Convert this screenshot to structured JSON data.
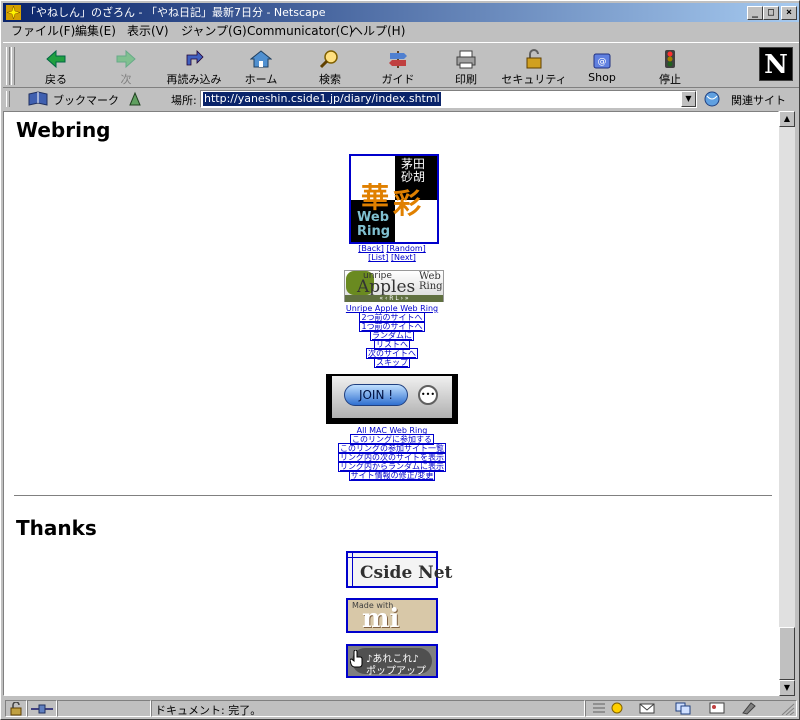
{
  "window": {
    "title": "「やねしん」のざろん - 「やね日記」最新7日分 - Netscape",
    "minimize": "_",
    "maximize": "□",
    "close": "×"
  },
  "menu": [
    "ファイル(F)",
    "編集(E)",
    "表示(V)",
    "ジャンプ(G)",
    "Communicator(C)",
    "ヘルプ(H)"
  ],
  "toolbar": {
    "back": "戻る",
    "forward": "次",
    "reload": "再読み込み",
    "home": "ホーム",
    "search": "検索",
    "guide": "ガイド",
    "print": "印刷",
    "security": "セキュリティ",
    "shop": "Shop",
    "stop": "停止",
    "logo": "N"
  },
  "locationbar": {
    "bookmarks_label": "ブックマーク",
    "location_label": "場所:",
    "url": "http://yaneshin.cside1.jp/diary/index.shtml",
    "related_label": "関連サイト"
  },
  "content": {
    "webring_heading": "Webring",
    "banner1": {
      "top_right": "茅田\n砂胡",
      "kanji1": "華",
      "kanji2": "彩",
      "web": "Web",
      "ring": "Ring"
    },
    "ring1_links": [
      "[Back]",
      "[Random]",
      "[List]",
      "[Next]"
    ],
    "banner2": {
      "unripe": "unripe",
      "apples": "Apples",
      "web": "Web",
      "ring": "Ring",
      "controls": "« ‹ R L › »"
    },
    "ring2_title": "Unripe Apple Web Ring",
    "ring2_links": [
      "2つ前のサイトへ",
      "1つ前のサイトへ",
      "ランダムに",
      "リストへ",
      "次のサイトへ",
      "スキップ"
    ],
    "banner3": {
      "join": "JOIN !"
    },
    "ring3_title": "All MAC Web Ring",
    "ring3_links": [
      "このリングに参加する",
      "このリングの参加サイト一覧",
      "リング内の次のサイトを表示",
      "リング内からランダムに表示",
      "サイト情報の修正/変更"
    ],
    "thanks_heading": "Thanks",
    "thanks1": "Cside Net",
    "thanks2_small": "Made with",
    "thanks2_big": "mi",
    "thanks3_line1": "♪あれこれ♪",
    "thanks3_line2": "ポップアップ"
  },
  "status": {
    "text": "ドキュメント: 完了。"
  }
}
